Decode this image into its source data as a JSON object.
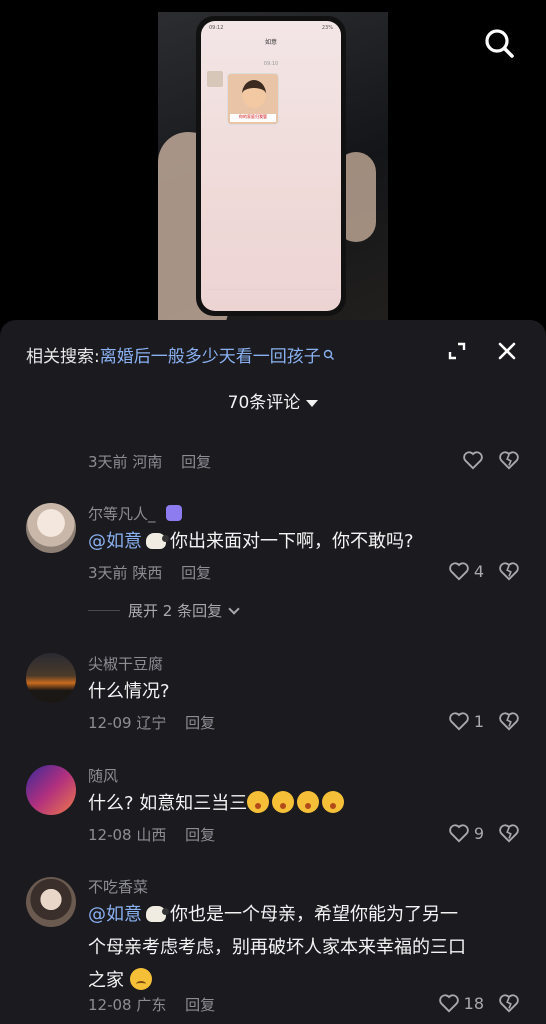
{
  "video": {
    "phone_status": {
      "time": "09:12",
      "battery": "23%"
    },
    "phone_chat_title": "如意",
    "phone_chat_time": "09:10",
    "sticker_caption": "你的家庭归我管"
  },
  "sheet": {
    "related_prefix": "相关搜索:",
    "related_keyword": "离婚后一般多少天看一回孩子",
    "comment_count": "70条评论"
  },
  "comments": [
    {
      "meta_time": "3天前",
      "meta_location": "河南",
      "reply_label": "回复",
      "likes": ""
    },
    {
      "username": "尔等凡人_",
      "mention": "@如意",
      "text": "你出来面对一下啊，你不敢吗?",
      "meta_time": "3天前",
      "meta_location": "陕西",
      "reply_label": "回复",
      "likes": "4",
      "expand_label": "展开 2 条回复"
    },
    {
      "username": "尖椒干豆腐",
      "text": "什么情况?",
      "meta_time": "12-09",
      "meta_location": "辽宁",
      "reply_label": "回复",
      "likes": "1"
    },
    {
      "username": "随风",
      "text": "什么? 如意知三当三",
      "meta_time": "12-08",
      "meta_location": "山西",
      "reply_label": "回复",
      "likes": "9"
    },
    {
      "username": "不吃香菜",
      "mention": "@如意",
      "text_line1": "你也是一个母亲，希望你能为了另一",
      "text_line2": "个母亲考虑考虑，别再破坏人家本来幸福的三口",
      "text_line3": "之家",
      "meta_time": "12-08",
      "meta_location": "广东",
      "reply_label": "回复",
      "likes": "18"
    }
  ],
  "colors": {
    "sheet_bg": "#1a1a1f",
    "link_blue": "#8ab1f2",
    "meta_gray": "#8d8d94"
  },
  "icons": [
    "search-icon",
    "search-small-icon",
    "expand-icon",
    "close-icon",
    "chevron-down-icon",
    "heart-icon",
    "broken-heart-icon",
    "sheep-emoji",
    "shocked-emoji",
    "sad-emoji"
  ]
}
